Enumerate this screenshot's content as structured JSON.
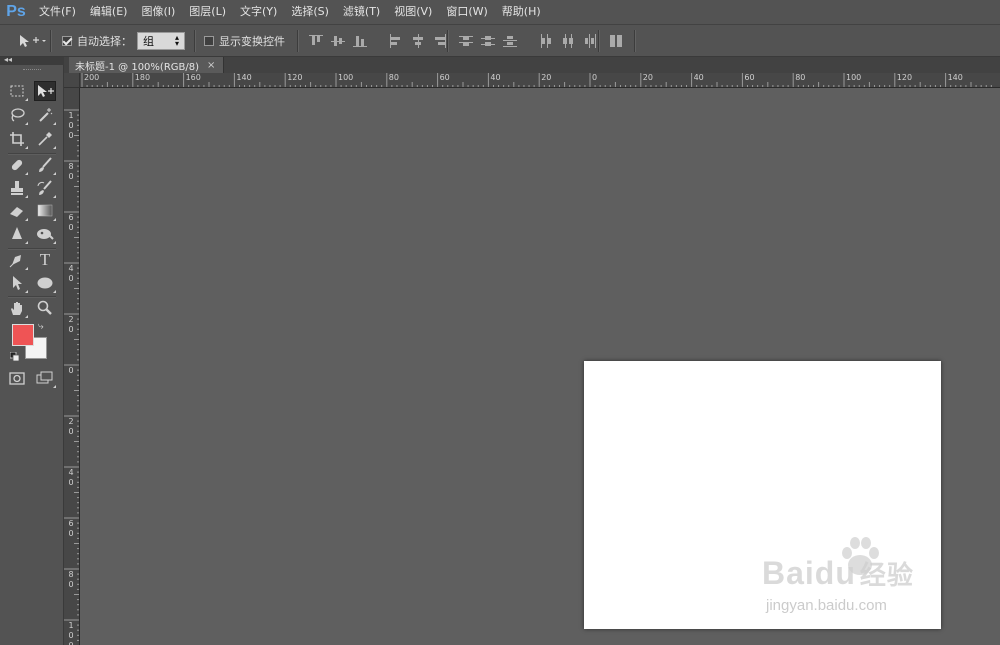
{
  "app": {
    "logo": "Ps"
  },
  "menu": [
    "文件(F)",
    "编辑(E)",
    "图像(I)",
    "图层(L)",
    "文字(Y)",
    "选择(S)",
    "滤镜(T)",
    "视图(V)",
    "窗口(W)",
    "帮助(H)"
  ],
  "options_bar": {
    "move_tool_icon": "move-arrow-icon",
    "auto_select_label": "自动选择：",
    "auto_select_checked": true,
    "auto_select_value": "组",
    "show_transform_label": "显示变换控件",
    "show_transform_checked": false
  },
  "document_tab": {
    "title": "未标题-1 @ 100%(RGB/8)",
    "close": "×"
  },
  "ruler": {
    "horizontal": [
      "200",
      "180",
      "160",
      "140",
      "120",
      "100",
      "80",
      "60",
      "40",
      "20",
      "0",
      "20",
      "40",
      "60",
      "80",
      "100",
      "120",
      "140"
    ],
    "vertical": [
      "100",
      "80",
      "60",
      "40",
      "20",
      "0",
      "20",
      "40",
      "60",
      "80",
      "100"
    ]
  },
  "toolbox": {
    "tools": [
      "marquee-tool",
      "move-tool",
      "lasso-tool",
      "magic-wand-tool",
      "crop-tool",
      "eyedropper-tool",
      "healing-brush-tool",
      "brush-tool",
      "clone-stamp-tool",
      "history-brush-tool",
      "eraser-tool",
      "gradient-tool",
      "blur-tool",
      "dodge-tool",
      "pen-tool",
      "type-tool",
      "path-selection-tool",
      "ellipse-tool",
      "hand-tool",
      "zoom-tool"
    ],
    "type_tool_glyph": "T",
    "foreground_color": "#ef5455",
    "background_color": "#f5f5f5"
  },
  "watermark": {
    "main": "Bai",
    "main2": "du",
    "cn": "经验",
    "sub": "jingyan.baidu.com"
  }
}
